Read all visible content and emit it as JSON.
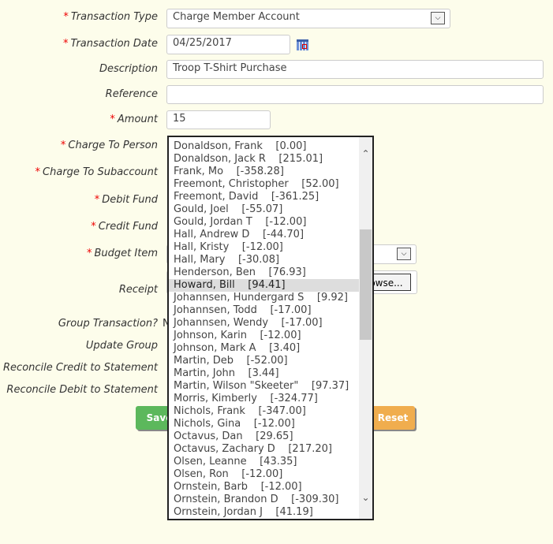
{
  "labels": {
    "transaction_type": "Transaction Type",
    "transaction_date": "Transaction Date",
    "description": "Description",
    "reference": "Reference",
    "amount": "Amount",
    "charge_to_person": "Charge To Person",
    "charge_to_subaccount": "Charge To Subaccount",
    "debit_fund": "Debit Fund",
    "credit_fund": "Credit Fund",
    "budget_item": "Budget Item",
    "receipt": "Receipt",
    "group_transaction": "Group Transaction?",
    "update_group": "Update Group",
    "reconcile_credit": "Reconcile Credit to Statement",
    "reconcile_debit": "Reconcile Debit to Statement"
  },
  "required_mark": "*",
  "values": {
    "transaction_type": "Charge Member Account",
    "transaction_date": "04/25/2017",
    "description": "Troop T-Shirt Purchase",
    "reference": "",
    "amount": "15",
    "group_transaction": "No"
  },
  "buttons": {
    "save": "Save",
    "browse": "Browse...",
    "reset": "Reset"
  },
  "colors": {
    "save": "#5cb85c",
    "reset": "#f0ad4e",
    "background": "#fdfdeb"
  },
  "person_dropdown": {
    "selected_index": 11,
    "options": [
      "Donaldson, Frank    [0.00]",
      "Donaldson, Jack R    [215.01]",
      "Frank, Mo    [-358.28]",
      "Freemont, Christopher    [52.00]",
      "Freemont, David    [-361.25]",
      "Gould, Joel    [-55.07]",
      "Gould, Jordan T    [-12.00]",
      "Hall, Andrew D    [-44.70]",
      "Hall, Kristy    [-12.00]",
      "Hall, Mary    [-30.08]",
      "Henderson, Ben    [76.93]",
      "Howard, Bill    [94.41]",
      "Johannsen, Hundergard S    [9.92]",
      "Johannsen, Todd    [-17.00]",
      "Johannsen, Wendy    [-17.00]",
      "Johnson, Karin    [-12.00]",
      "Johnson, Mark A    [3.40]",
      "Martin, Deb    [-52.00]",
      "Martin, John    [3.44]",
      "Martin, Wilson \"Skeeter\"    [97.37]",
      "Morris, Kimberly    [-324.77]",
      "Nichols, Frank    [-347.00]",
      "Nichols, Gina    [-12.00]",
      "Octavus, Dan    [29.65]",
      "Octavus, Zachary D    [217.20]",
      "Olsen, Leanne    [43.35]",
      "Olsen, Ron    [-12.00]",
      "Ornstein, Barb    [-12.00]",
      "Ornstein, Brandon D    [-309.30]",
      "Ornstein, Jordan J    [41.19]"
    ]
  }
}
